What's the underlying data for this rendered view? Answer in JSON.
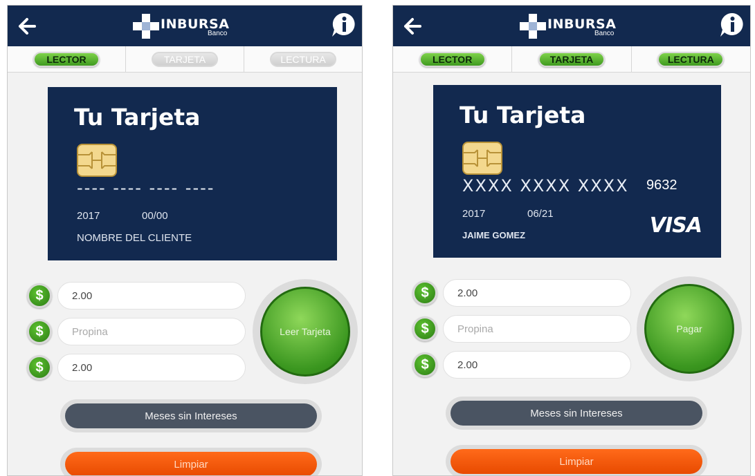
{
  "brand": {
    "name": "INBURSA",
    "sub": "Banco"
  },
  "screens": [
    {
      "steps": [
        {
          "label": "LECTOR",
          "state": "active"
        },
        {
          "label": "TARJETA",
          "state": "inactive"
        },
        {
          "label": "LECTURA",
          "state": "inactive"
        }
      ],
      "card": {
        "title": "Tu Tarjeta",
        "number": "---- ---- ---- ----",
        "last4": "",
        "year": "2017",
        "expiry": "00/00",
        "holder": "NOMBRE DEL CLIENTE",
        "brand": ""
      },
      "fields": [
        {
          "value": "2.00",
          "placeholder": ""
        },
        {
          "value": "",
          "placeholder": "Propina"
        },
        {
          "value": "2.00",
          "placeholder": ""
        }
      ],
      "currency_symbol": "$",
      "primary_button": "Leer Tarjeta",
      "msi_button": "Meses sin Intereses",
      "clear_button": "Limpiar"
    },
    {
      "steps": [
        {
          "label": "LECTOR",
          "state": "active"
        },
        {
          "label": "TARJETA",
          "state": "active"
        },
        {
          "label": "LECTURA",
          "state": "active"
        }
      ],
      "card": {
        "title": "Tu Tarjeta",
        "number": "XXXX XXXX XXXX",
        "last4": "9632",
        "year": "2017",
        "expiry": "06/21",
        "holder": "JAIME GOMEZ",
        "brand": "VISA"
      },
      "fields": [
        {
          "value": "2.00",
          "placeholder": ""
        },
        {
          "value": "",
          "placeholder": "Propina"
        },
        {
          "value": "2.00",
          "placeholder": ""
        }
      ],
      "currency_symbol": "$",
      "primary_button": "Pagar",
      "msi_button": "Meses sin Intereses",
      "clear_button": "Limpiar"
    }
  ],
  "colors": {
    "header_navy": "#12294f",
    "accent_green": "#3f9a1f",
    "msi_gray": "#4a5462",
    "clear_orange": "#f25a0a"
  },
  "icons": [
    "back-arrow-icon",
    "info-bubble-icon",
    "dollar-icon",
    "card-chip-icon",
    "inbursa-logo-icon"
  ]
}
